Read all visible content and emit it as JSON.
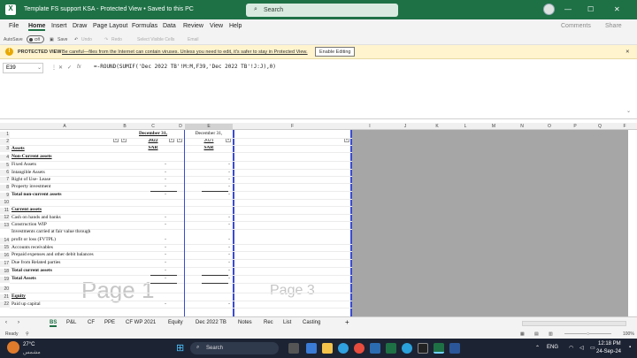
{
  "titlebar": {
    "title": "Template FS support KSA  -  Protected View • Saved to this PC",
    "search_placeholder": "Search",
    "minimize": "—",
    "maximize": "☐",
    "close": "✕"
  },
  "menu": {
    "items": [
      "File",
      "Home",
      "Insert",
      "Draw",
      "Page Layout",
      "Formulas",
      "Data",
      "Review",
      "View",
      "Help"
    ],
    "comments": "Comments",
    "share": "Share"
  },
  "toolbar": {
    "autosave": "AutoSave",
    "toggle": "Off",
    "save": "Save",
    "undo": "Undo",
    "redo": "Redo",
    "select_visible": "Select Visible Cells",
    "email": "Email"
  },
  "protected_view": {
    "label": "PROTECTED VIEW",
    "message": "Be careful—files from the Internet can contain viruses. Unless you need to edit, it's safer to stay in Protected View.",
    "button": "Enable Editing"
  },
  "formula_bar": {
    "name_box": "E39",
    "fx": "fx",
    "formula": "=-ROUND(SUMIF('Dec 2022 TB'!M:M,F39,'Dec 2022 TB'!J:J),0)"
  },
  "columns": [
    "A",
    "B",
    "C",
    "D",
    "E",
    "F",
    "I",
    "J",
    "K",
    "L",
    "M",
    "N",
    "O",
    "P",
    "Q",
    "F"
  ],
  "sheet": {
    "header_c": [
      "December 31,",
      "2022",
      "SAR"
    ],
    "header_e": [
      "December 31,",
      "2021",
      "SAR"
    ],
    "rows": [
      {
        "n": "1",
        "a": "",
        "c": "",
        "e": ""
      },
      {
        "n": "2",
        "a": "",
        "c": "",
        "e": ""
      },
      {
        "n": "3",
        "a": "Assets",
        "c": "",
        "e": ""
      },
      {
        "n": "4",
        "a": "Non-Current assets",
        "c": "",
        "e": ""
      },
      {
        "n": "5",
        "a": "Fixed Assets",
        "c": "-",
        "e": "-"
      },
      {
        "n": "6",
        "a": "Intangible Assets",
        "c": "-",
        "e": "-"
      },
      {
        "n": "7",
        "a": "Right of Use- Lease",
        "c": "-",
        "e": "-"
      },
      {
        "n": "8",
        "a": "Property investment",
        "c": "-",
        "e": "-"
      },
      {
        "n": "9",
        "a": "Total non-current assets",
        "c": "-",
        "e": "-"
      },
      {
        "n": "10",
        "a": "",
        "c": "",
        "e": ""
      },
      {
        "n": "11",
        "a": "Current assets",
        "c": "",
        "e": ""
      },
      {
        "n": "12",
        "a": "Cash on hands and banks",
        "c": "-",
        "e": "-"
      },
      {
        "n": "13",
        "a": "Construction WIP",
        "c": "-",
        "e": "-"
      },
      {
        "n": "14",
        "a": "Investments carried at fair value through",
        "a2": "profit or loss (FVTPL)",
        "c": "-",
        "e": "-"
      },
      {
        "n": "15",
        "a": "Accounts receivables",
        "c": "-",
        "e": "-"
      },
      {
        "n": "16",
        "a": "Prepaid expenses and other debit balances",
        "c": "-",
        "e": "-"
      },
      {
        "n": "17",
        "a": "Due from Related parties",
        "c": "-",
        "e": "-"
      },
      {
        "n": "18",
        "a": "Total current assets",
        "c": "-",
        "e": "-"
      },
      {
        "n": "19",
        "a": "Total Assets",
        "c": "-",
        "e": "-"
      },
      {
        "n": "20",
        "a": "",
        "c": "",
        "e": ""
      },
      {
        "n": "21",
        "a": "Equity",
        "c": "",
        "e": ""
      },
      {
        "n": "22",
        "a": "Paid up capital",
        "c": "-",
        "e": "-"
      }
    ],
    "watermark1": "Page 1",
    "watermark3": "Page 3"
  },
  "tabs": [
    "BS",
    "P&L",
    "CF",
    "PPE",
    "CF WP 2021",
    "Equity",
    "Dec 2022 TB",
    "Notes",
    "Rec",
    "List",
    "Casting"
  ],
  "status": {
    "ready": "Ready",
    "zoom": "100%"
  },
  "taskbar": {
    "weather_temp": "27°C",
    "weather_desc": "مشمس",
    "search": "Search",
    "lang": "ENG",
    "time": "12:18 PM",
    "date": "24-Sep-24"
  }
}
